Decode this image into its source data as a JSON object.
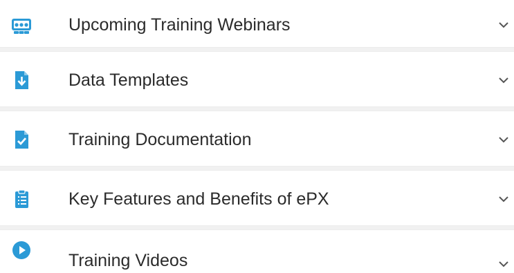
{
  "accent_color": "#2b9ad6",
  "accordion": {
    "items": [
      {
        "label": "Upcoming Training Webinars",
        "icon": "webinar-icon",
        "chevron": "chevron-down-icon"
      },
      {
        "label": "Data Templates",
        "icon": "file-download-icon",
        "chevron": "chevron-down-icon"
      },
      {
        "label": "Training Documentation",
        "icon": "file-check-icon",
        "chevron": "chevron-down-icon"
      },
      {
        "label": "Key Features and Benefits of ePX",
        "icon": "clipboard-list-icon",
        "chevron": "chevron-down-icon"
      },
      {
        "label": "Training Videos",
        "icon": "play-circle-icon",
        "chevron": "chevron-down-icon"
      }
    ]
  }
}
